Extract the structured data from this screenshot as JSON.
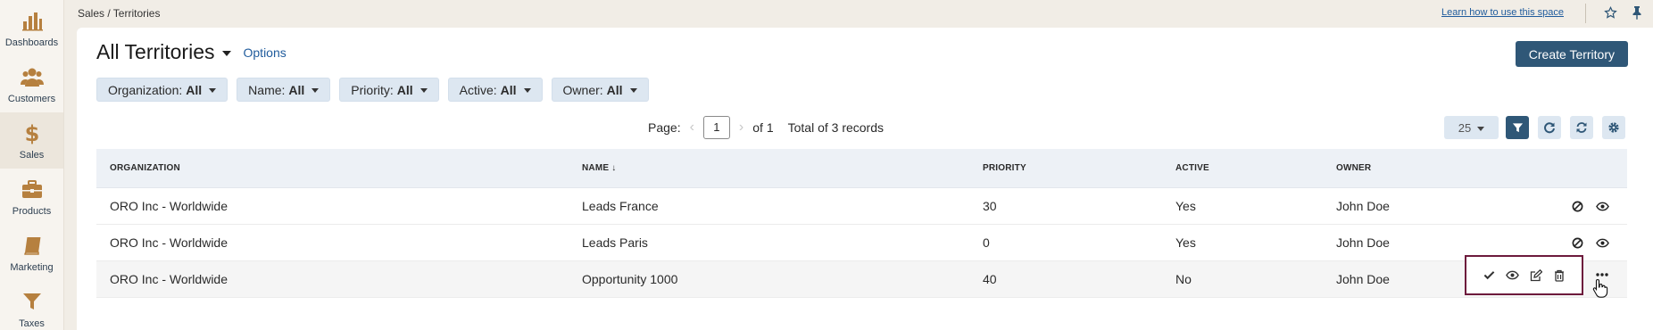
{
  "sidebar": {
    "items": [
      {
        "label": "Dashboards",
        "icon": "bar-chart-icon"
      },
      {
        "label": "Customers",
        "icon": "users-icon"
      },
      {
        "label": "Sales",
        "icon": "dollar-icon",
        "active": true
      },
      {
        "label": "Products",
        "icon": "briefcase-icon"
      },
      {
        "label": "Marketing",
        "icon": "book-icon"
      },
      {
        "label": "Taxes",
        "icon": "filter-icon"
      }
    ]
  },
  "topbar": {
    "breadcrumb": "Sales / Territories",
    "learn_link": "Learn how to use this space"
  },
  "header": {
    "title": "All Territories",
    "options_label": "Options",
    "create_button": "Create Territory"
  },
  "filters": [
    {
      "label": "Organization:",
      "value": "All"
    },
    {
      "label": "Name:",
      "value": "All"
    },
    {
      "label": "Priority:",
      "value": "All"
    },
    {
      "label": "Active:",
      "value": "All"
    },
    {
      "label": "Owner:",
      "value": "All"
    }
  ],
  "pager": {
    "page_label": "Page:",
    "current_page": "1",
    "of_label": "of 1",
    "total_label": "Total of 3 records",
    "per_page": "25"
  },
  "grid": {
    "columns": [
      "ORGANIZATION",
      "NAME",
      "PRIORITY",
      "ACTIVE",
      "OWNER"
    ],
    "sort_column": "NAME",
    "rows": [
      {
        "organization": "ORO Inc - Worldwide",
        "name": "Leads France",
        "priority": "30",
        "active": "Yes",
        "owner": "John Doe"
      },
      {
        "organization": "ORO Inc - Worldwide",
        "name": "Leads Paris",
        "priority": "0",
        "active": "Yes",
        "owner": "John Doe"
      },
      {
        "organization": "ORO Inc - Worldwide",
        "name": "Opportunity 1000",
        "priority": "40",
        "active": "No",
        "owner": "John Doe"
      }
    ]
  },
  "colors": {
    "primary": "#2f5777",
    "accent_icon": "#b6803f",
    "highlight_border": "#6d1a3c",
    "link": "#1f5b9c"
  }
}
